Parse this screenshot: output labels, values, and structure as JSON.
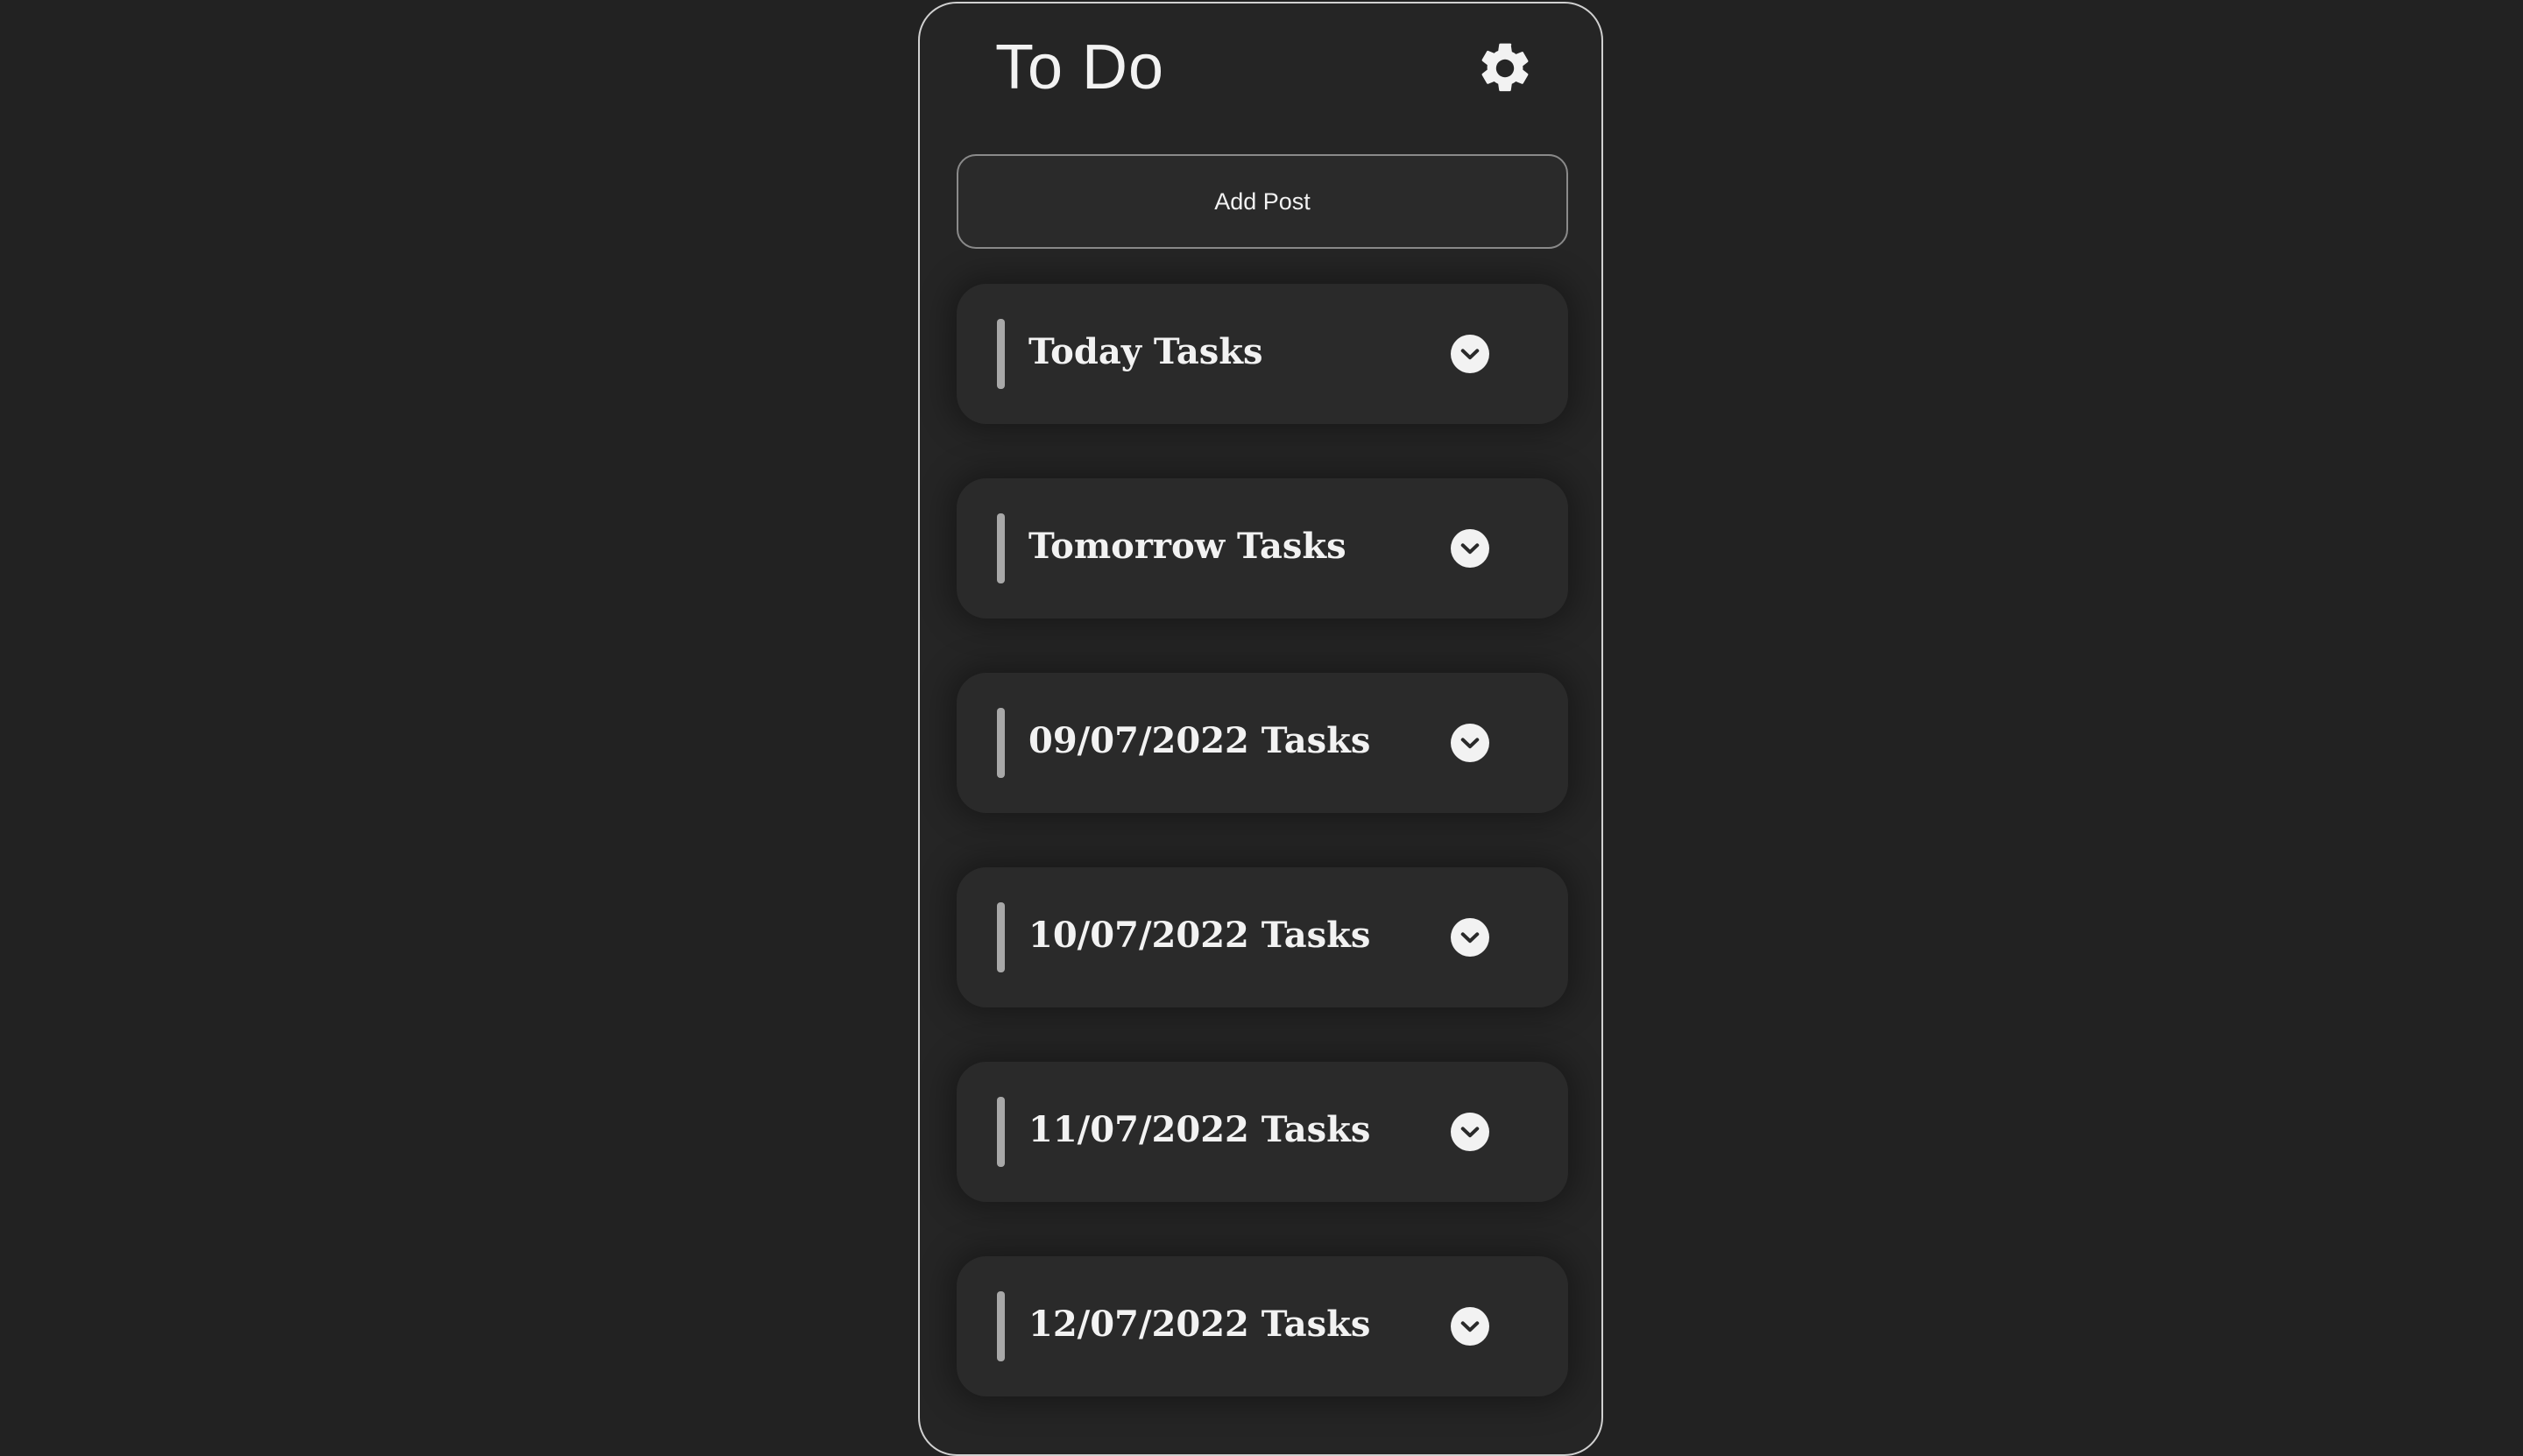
{
  "app": {
    "title": "To Do",
    "settings_icon": "gear-icon"
  },
  "actions": {
    "add_post_label": "Add Post"
  },
  "task_groups": [
    {
      "label": "Today Tasks",
      "icon": "chevron-down-icon"
    },
    {
      "label": "Tomorrow Tasks",
      "icon": "chevron-down-icon"
    },
    {
      "label": "09/07/2022 Tasks",
      "icon": "chevron-down-icon"
    },
    {
      "label": "10/07/2022 Tasks",
      "icon": "chevron-down-icon"
    },
    {
      "label": "11/07/2022 Tasks",
      "icon": "chevron-down-icon"
    },
    {
      "label": "12/07/2022 Tasks",
      "icon": "chevron-down-icon"
    }
  ],
  "colors": {
    "background": "#222222",
    "panel": "#252525",
    "card": "#2a2a2a",
    "text": "#f2f2f2",
    "accent_bar": "#a8a8a8"
  }
}
